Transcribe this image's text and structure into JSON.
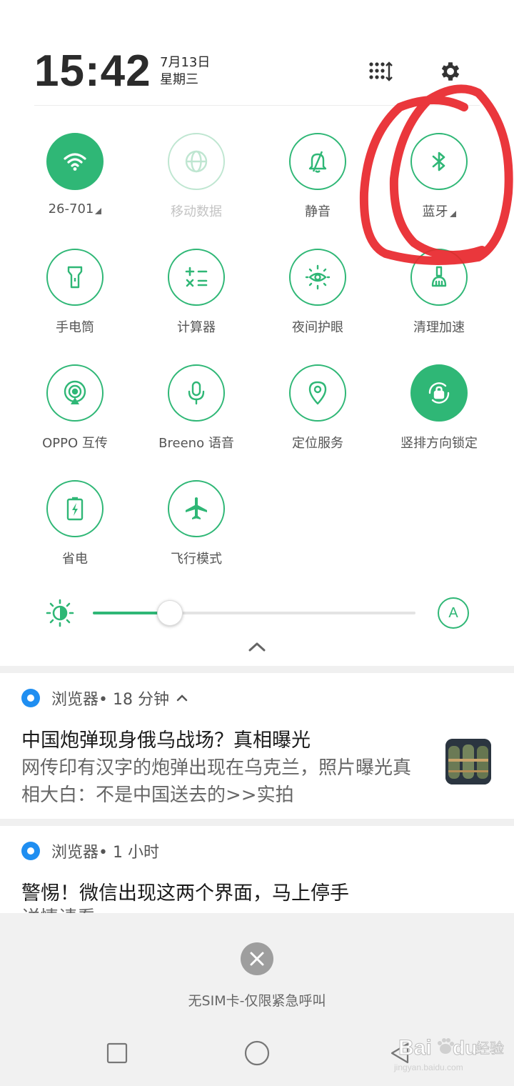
{
  "header": {
    "time": "15:42",
    "date": "7月13日",
    "weekday": "星期三",
    "edit_icon": "grid-sort-icon",
    "settings_icon": "gear-icon"
  },
  "tiles": [
    {
      "label": "26-701",
      "icon": "wifi-icon",
      "state": "on",
      "has_more": true
    },
    {
      "label": "移动数据",
      "icon": "globe-icon",
      "state": "disabled",
      "has_more": false
    },
    {
      "label": "静音",
      "icon": "bell-mute-icon",
      "state": "off",
      "has_more": false
    },
    {
      "label": "蓝牙",
      "icon": "bluetooth-icon",
      "state": "off",
      "has_more": true
    },
    {
      "label": "手电筒",
      "icon": "flashlight-icon",
      "state": "off"
    },
    {
      "label": "计算器",
      "icon": "calculator-icon",
      "state": "off"
    },
    {
      "label": "夜间护眼",
      "icon": "eye-sun-icon",
      "state": "off"
    },
    {
      "label": "清理加速",
      "icon": "broom-icon",
      "state": "off"
    },
    {
      "label": "OPPO 互传",
      "icon": "share-signal-icon",
      "state": "off"
    },
    {
      "label": "Breeno 语音",
      "icon": "microphone-icon",
      "state": "off"
    },
    {
      "label": "定位服务",
      "icon": "location-pin-icon",
      "state": "off"
    },
    {
      "label": "竖排方向锁定",
      "icon": "rotation-lock-icon",
      "state": "on"
    },
    {
      "label": "省电",
      "icon": "battery-bolt-icon",
      "state": "off"
    },
    {
      "label": "飞行模式",
      "icon": "airplane-icon",
      "state": "off"
    }
  ],
  "brightness": {
    "level": 0.24,
    "auto_label": "A",
    "icon": "brightness-sun-icon"
  },
  "notifications": [
    {
      "app": "浏览器",
      "meta": " • 18 分钟",
      "expanded_icon": "chevron-up-icon",
      "title": "中国炮弹现身俄乌战场？真相曝光",
      "body": "网传印有汉字的炮弹出现在乌克兰，照片曝光真相大白：不是中国送去的>>实拍",
      "has_thumbnail": true
    },
    {
      "app": "浏览器",
      "meta": " • 1 小时",
      "title": "警惕！微信出现这两个界面，马上停手",
      "body": "详情请看"
    }
  ],
  "footer": {
    "sim_status": "无SIM卡-仅限紧急呼叫",
    "dismiss_icon": "close-icon"
  },
  "nav": {
    "recent_icon": "square-icon",
    "home_icon": "circle-icon",
    "back_icon": "triangle-back-icon"
  },
  "watermark": {
    "brand": "Bai",
    "brand2": "du",
    "brand3": "经验",
    "url": "jingyan.baidu.com"
  },
  "colors": {
    "accent": "#2fb776",
    "annotation": "#e8262b"
  }
}
